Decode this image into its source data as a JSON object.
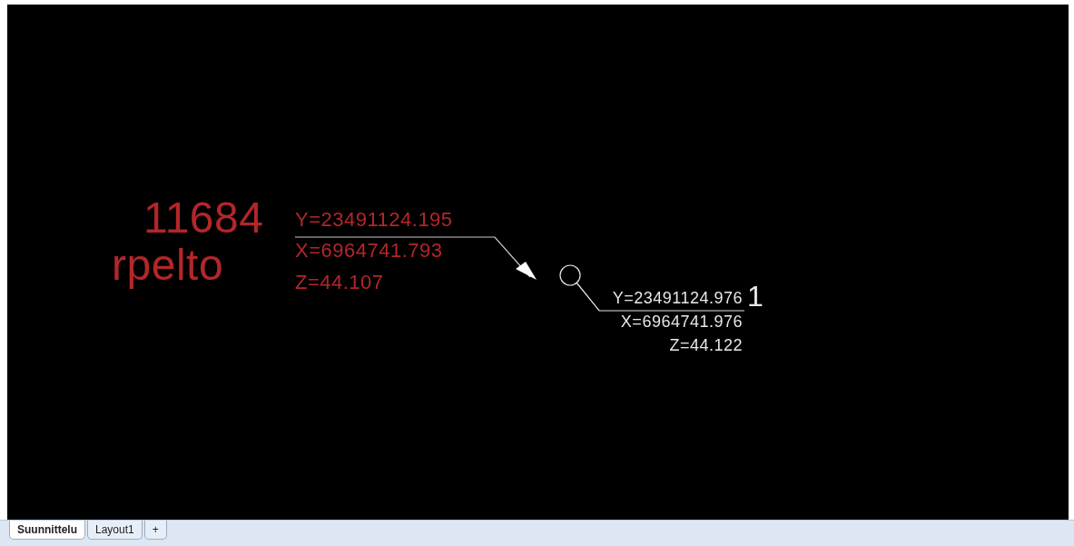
{
  "drawing": {
    "labels": [
      {
        "color": "#b3262a",
        "number": "11684",
        "name": "rpelto",
        "y": "Y=23491124.195",
        "x": "X=6964741.793",
        "z": "Z=44.107"
      },
      {
        "color": "#e6e6e6",
        "number": "1",
        "y": "Y=23491124.976",
        "x": "X=6964741.976",
        "z": "Z=44.122"
      }
    ]
  },
  "tabs": [
    {
      "label": "Suunnittelu",
      "selected": true
    },
    {
      "label": "Layout1",
      "selected": false
    },
    {
      "label": "+",
      "selected": false
    }
  ]
}
